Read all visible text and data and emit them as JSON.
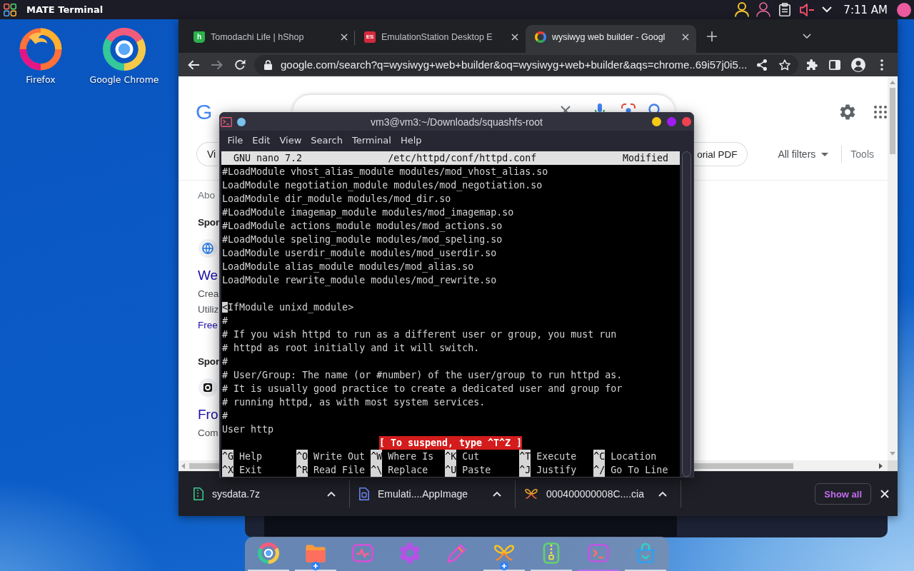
{
  "top_panel": {
    "app_name": "MATE Terminal",
    "volume_muted": true,
    "clock": "7:11 AM"
  },
  "desktop_icons": [
    {
      "kind": "swirl",
      "label": "Firefox"
    },
    {
      "kind": "ring",
      "label": "Google Chrome"
    }
  ],
  "browser": {
    "tabs": [
      {
        "kind": "bag",
        "icon_text": "h",
        "color": "#2bb24c",
        "title": "Tomodachi Life | hShop",
        "selected": false
      },
      {
        "kind": "tile",
        "icon_text": "ES",
        "color": "#d42a3c",
        "title": "EmulationStation Desktop E",
        "selected": false
      },
      {
        "kind": "ring",
        "title": "wysiwyg web builder - Googl",
        "selected": true
      }
    ],
    "can_go_forward": false,
    "address": "google.com/search?q=wysiwyg+web+builder&oq=wysiwyg+web+builder&aqs=chrome..69i57j0i5...",
    "page": {
      "logo": "G",
      "chips": [
        {
          "label": "Vi"
        },
        {
          "label": "orial PDF"
        }
      ],
      "all_filters": "All filters",
      "tools": "Tools",
      "result_stats": "Abo",
      "ads": [
        {
          "heading": "Spor",
          "icon": {
            "kind": "globe"
          },
          "title": "We",
          "lines": [
            "Crea",
            "Utiliz"
          ],
          "link": "Free"
        },
        {
          "heading": "Spor",
          "icon": {
            "kind": "logo"
          },
          "title": "Fro",
          "lines": [
            "Com"
          ]
        }
      ]
    },
    "downloads": [
      {
        "kind": "zip",
        "name": "sysdata.7z"
      },
      {
        "kind": "file",
        "name": "Emulati....AppImage"
      },
      {
        "kind": "butterfly",
        "name": "000400000008C....cia"
      }
    ],
    "show_all": "Show all"
  },
  "terminal": {
    "title": "vm3@vm3:~/Downloads/squashfs-root",
    "menu": [
      "File",
      "Edit",
      "View",
      "Search",
      "Terminal",
      "Help"
    ],
    "editor": "GNU nano 7.2",
    "file": "/etc/httpd/conf/httpd.conf",
    "file_state": "Modified",
    "lines": [
      {
        "kind": "text",
        "text": "#LoadModule vhost_alias_module modules/mod_vhost_alias.so",
        "cursor": false
      },
      {
        "kind": "text",
        "text": "LoadModule negotiation_module modules/mod_negotiation.so",
        "cursor": false
      },
      {
        "kind": "text",
        "text": "LoadModule dir_module modules/mod_dir.so",
        "cursor": false
      },
      {
        "kind": "text",
        "text": "#LoadModule imagemap_module modules/mod_imagemap.so",
        "cursor": false
      },
      {
        "kind": "text",
        "text": "#LoadModule actions_module modules/mod_actions.so",
        "cursor": false
      },
      {
        "kind": "text",
        "text": "#LoadModule speling_module modules/mod_speling.so",
        "cursor": false
      },
      {
        "kind": "text",
        "text": "LoadModule userdir_module modules/mod_userdir.so",
        "cursor": false
      },
      {
        "kind": "text",
        "text": "LoadModule alias_module modules/mod_alias.so",
        "cursor": false
      },
      {
        "kind": "text",
        "text": "LoadModule rewrite_module modules/mod_rewrite.so",
        "cursor": false
      },
      {
        "kind": "blank"
      },
      {
        "kind": "text",
        "text": "<IfModule unixd_module>",
        "cursor": true
      },
      {
        "kind": "text",
        "text": "#",
        "cursor": false
      },
      {
        "kind": "text",
        "text": "# If you wish httpd to run as a different user or group, you must run",
        "cursor": false
      },
      {
        "kind": "text",
        "text": "# httpd as root initially and it will switch.",
        "cursor": false
      },
      {
        "kind": "text",
        "text": "#",
        "cursor": false
      },
      {
        "kind": "text",
        "text": "# User/Group: The name (or #number) of the user/group to run httpd as.",
        "cursor": false
      },
      {
        "kind": "text",
        "text": "# It is usually good practice to create a dedicated user and group for",
        "cursor": false
      },
      {
        "kind": "text",
        "text": "# running httpd, as with most system services.",
        "cursor": false
      },
      {
        "kind": "text",
        "text": "#",
        "cursor": false
      },
      {
        "kind": "text",
        "text": "User http",
        "cursor": false
      }
    ],
    "message": "[ To suspend, type ^T^Z ]",
    "shortcut_rows": [
      [
        {
          "key": "^G",
          "label": "Help"
        },
        {
          "key": "^O",
          "label": "Write Out"
        },
        {
          "key": "^W",
          "label": "Where Is"
        },
        {
          "key": "^K",
          "label": "Cut"
        },
        {
          "key": "^T",
          "label": "Execute"
        },
        {
          "key": "^C",
          "label": "Location"
        }
      ],
      [
        {
          "key": "^X",
          "label": "Exit"
        },
        {
          "key": "^R",
          "label": "Read File"
        },
        {
          "key": "^\\",
          "label": "Replace"
        },
        {
          "key": "^U",
          "label": "Paste"
        },
        {
          "key": "^J",
          "label": "Justify"
        },
        {
          "key": "^/",
          "label": "Go To Line"
        }
      ]
    ]
  },
  "dock": {
    "items": [
      {
        "kind": "ring",
        "running": true,
        "selected": false,
        "badge": false
      },
      {
        "kind": "folder",
        "running": true,
        "selected": false,
        "badge": true
      },
      {
        "kind": "pulse",
        "running": false,
        "selected": false,
        "badge": false
      },
      {
        "kind": "gear",
        "running": false,
        "selected": false,
        "badge": false
      },
      {
        "kind": "pen",
        "running": false,
        "selected": false,
        "badge": false
      },
      {
        "kind": "butterfly",
        "running": true,
        "selected": false,
        "badge": true
      },
      {
        "kind": "zip",
        "running": true,
        "selected": false,
        "badge": false
      },
      {
        "kind": "terminal",
        "running": true,
        "selected": true,
        "badge": false
      },
      {
        "kind": "bag",
        "running": true,
        "selected": false,
        "badge": false
      }
    ]
  }
}
